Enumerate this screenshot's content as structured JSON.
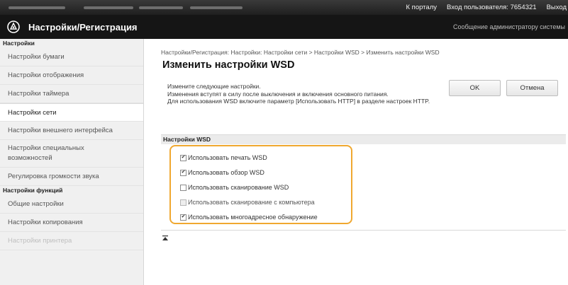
{
  "topbar": {
    "portal_link": "К порталу",
    "login_label": "Вход пользователя:",
    "user_id": "7654321",
    "logout_link": "Выход"
  },
  "header": {
    "logo_icon": "settings-registration-logo-icon",
    "title": "Настройки/Регистрация",
    "admin_message": "Сообщение администратору системы"
  },
  "sidebar": {
    "section_settings": "Настройки",
    "items_settings": [
      {
        "label": "Настройки бумаги"
      },
      {
        "label": "Настройки отображения"
      },
      {
        "label": "Настройки таймера"
      },
      {
        "label": "Настройки сети"
      },
      {
        "label": "Настройки внешнего интерфейса"
      },
      {
        "label": "Настройки специальных возможностей"
      },
      {
        "label": "Регулировка громкости звука"
      }
    ],
    "section_functions": "Настройки функций",
    "items_functions": [
      {
        "label": "Общие настройки"
      },
      {
        "label": "Настройки копирования"
      },
      {
        "label": "Настройки принтера"
      }
    ],
    "active_item": "Настройки сети"
  },
  "main": {
    "breadcrumb": "Настройки/Регистрация: Настройки: Настройки сети > Настройки WSD > Изменить настройки WSD",
    "title": "Изменить настройки WSD",
    "description": "Измените следующие настройки.\nИзменения вступят в силу после выключения и включения основного питания.\nДля использования WSD включите параметр [Использовать HTTP] в разделе настроек HTTP.",
    "ok_label": "OK",
    "cancel_label": "Отмена",
    "panel_title": "Настройки WSD",
    "options": [
      {
        "label": "Использовать печать WSD",
        "checked": true,
        "enabled": true
      },
      {
        "label": "Использовать обзор WSD",
        "checked": true,
        "enabled": true
      },
      {
        "label": "Использовать сканирование WSD",
        "checked": false,
        "enabled": true
      },
      {
        "label": "Использовать сканирование с компьютера",
        "checked": false,
        "enabled": false
      },
      {
        "label": "Использовать многоадресное обнаружение",
        "checked": true,
        "enabled": true
      }
    ],
    "highlight_color": "#f0a830",
    "back_to_top_icon": "back-to-top-icon"
  }
}
